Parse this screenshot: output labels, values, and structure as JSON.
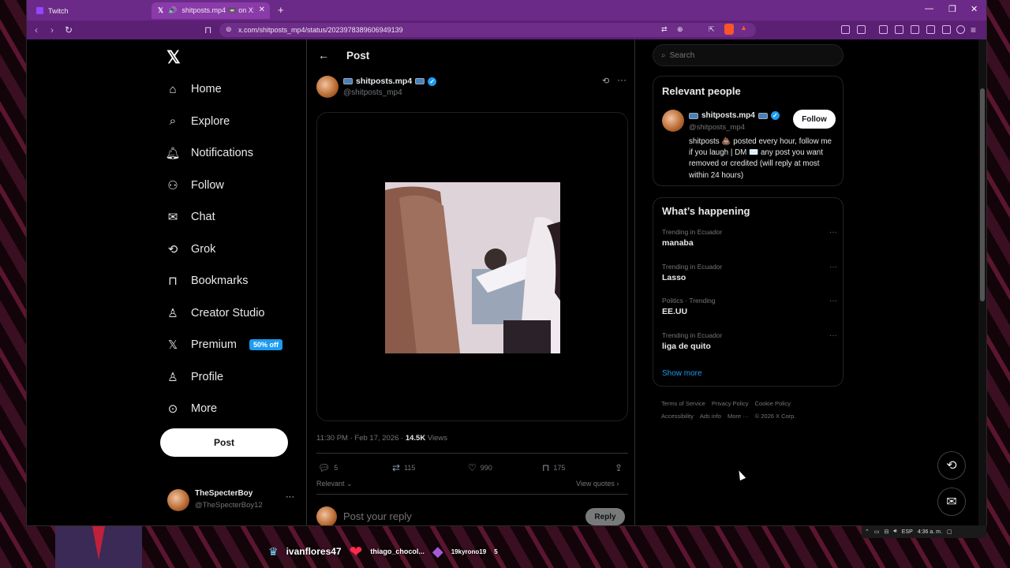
{
  "browser": {
    "tabs": [
      {
        "label": "Twitch"
      },
      {
        "label": "shitposts.mp4 📼 on X: \"..."
      }
    ],
    "url": "x.com/shitposts_mp4/status/2023978389606949139"
  },
  "nav": {
    "items": [
      {
        "label": "Home",
        "icon": "home-icon"
      },
      {
        "label": "Explore",
        "icon": "search-icon"
      },
      {
        "label": "Notifications",
        "icon": "bell-icon"
      },
      {
        "label": "Follow",
        "icon": "person-add-icon"
      },
      {
        "label": "Chat",
        "icon": "mail-icon"
      },
      {
        "label": "Grok",
        "icon": "grok-icon"
      },
      {
        "label": "Bookmarks",
        "icon": "bookmark-icon"
      },
      {
        "label": "Creator Studio",
        "icon": "creator-studio-icon"
      },
      {
        "label": "Premium",
        "icon": "x-logo-icon"
      },
      {
        "label": "Profile",
        "icon": "person-icon"
      },
      {
        "label": "More",
        "icon": "more-circle-icon"
      }
    ],
    "premium_badge": "50% off",
    "post_label": "Post"
  },
  "account": {
    "name": "TheSpecterBoy",
    "handle": "@TheSpecterBoy12"
  },
  "post": {
    "header_title": "Post",
    "author_name": "shitposts.mp4",
    "author_handle": "@shitposts_mp4",
    "time": "11:30 PM · Feb 17, 2026 · ",
    "views_count": "14.5K",
    "views_label": " Views",
    "stats": {
      "replies": "5",
      "reposts": "115",
      "likes": "990",
      "bookmarks": "175"
    },
    "relevant_label": "Relevant ⌄",
    "view_quotes_label": "View quotes ›",
    "reply_placeholder": "Post your reply",
    "reply_button": "Reply"
  },
  "sidebar": {
    "search_placeholder": "Search",
    "relevant_title": "Relevant people",
    "person": {
      "name": "shitposts.mp4",
      "handle": "@shitposts_mp4",
      "follow_label": "Follow",
      "bio": "shitposts 💩 posted every hour, follow me if you laugh | DM ✉️ any post you want removed or credited (will reply at most within 24 hours)"
    },
    "happening_title": "What’s happening",
    "trends": [
      {
        "context": "Trending in Ecuador",
        "name": "manaba"
      },
      {
        "context": "Trending in Ecuador",
        "name": "Lasso"
      },
      {
        "context": "Politics · Trending",
        "name": "EE.UU"
      },
      {
        "context": "Trending in Ecuador",
        "name": "liga de quito"
      }
    ],
    "show_more": "Show more",
    "footer_links": [
      "Terms of Service",
      "Privacy Policy",
      "Cookie Policy",
      "Accessibility",
      "Ads info",
      "More ···",
      "© 2026 X Corp."
    ]
  },
  "taskbar": {
    "lang": "ESP",
    "time": "4:36 a. m."
  },
  "stream_overlay": {
    "viewer1": "ivanflores47",
    "viewer2": "thiago_chocol...",
    "viewer3": "19kyrono19",
    "viewer3_count": "5"
  },
  "colors": {
    "accent": "#1d9bf0",
    "browser_frame": "#6c2a88",
    "page_bg": "#000000"
  }
}
